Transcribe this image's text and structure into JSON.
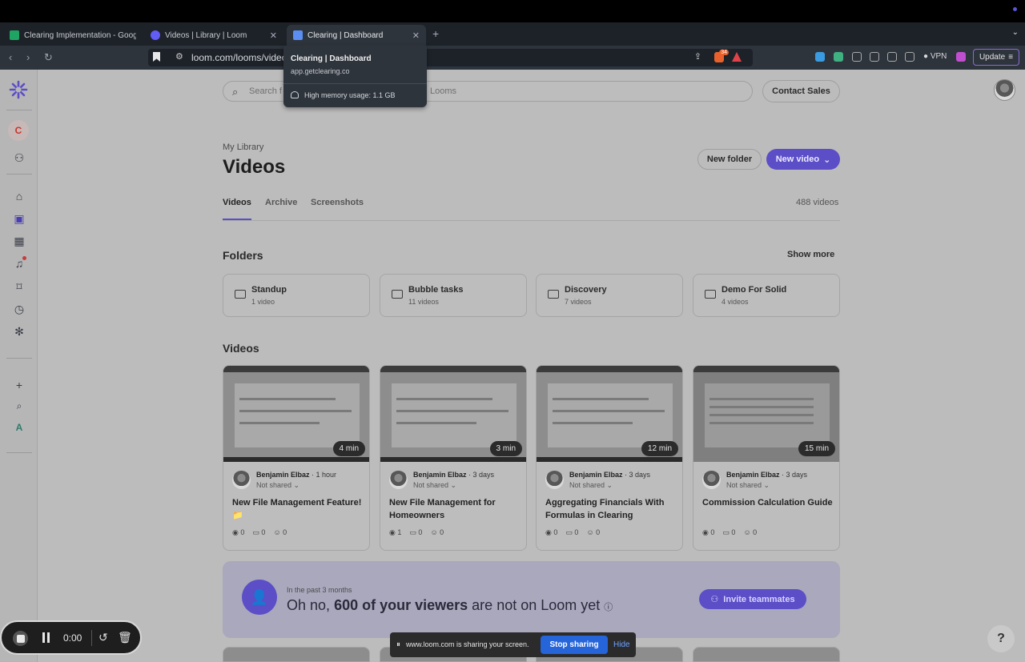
{
  "browser": {
    "tabs": [
      {
        "label": "Clearing Implementation - Googl",
        "favicon_color": "#1fa463"
      },
      {
        "label": "Videos | Library | Loom",
        "favicon_color": "#625df5"
      },
      {
        "label": "Clearing | Dashboard",
        "favicon_color": "#5a8ef0"
      }
    ],
    "url": "loom.com/looms/videos",
    "tooltip": {
      "title": "Clearing | Dashboard",
      "url": "app.getclearing.co",
      "memory": "High memory usage: 1.1 GB"
    },
    "shield_count": "34",
    "vpn_label": "VPN",
    "update_label": "Update"
  },
  "sidebar": {
    "workspace_initial": "C",
    "bottom_letter": "A"
  },
  "search": {
    "placeholder_left": "Search f",
    "placeholder_right": "Looms"
  },
  "contact_sales": "Contact Sales",
  "header": {
    "breadcrumb": "My Library",
    "title": "Videos",
    "new_folder": "New folder",
    "new_video": "New video"
  },
  "tabs": [
    "Videos",
    "Archive",
    "Screenshots"
  ],
  "video_count": "488 videos",
  "folders_section": {
    "title": "Folders",
    "show_more": "Show more",
    "items": [
      {
        "name": "Standup",
        "count": "1 video"
      },
      {
        "name": "Bubble tasks",
        "count": "11 videos"
      },
      {
        "name": "Discovery",
        "count": "7 videos"
      },
      {
        "name": "Demo For Solid",
        "count": "4 videos"
      }
    ]
  },
  "videos_section": {
    "title": "Videos",
    "items": [
      {
        "duration": "4 min",
        "author": "Benjamin Elbaz",
        "time": "· 1 hour",
        "shared": "Not shared",
        "title": "New File Management Feature! 📁",
        "views": "0",
        "comments": "0",
        "reactions": "0"
      },
      {
        "duration": "3 min",
        "author": "Benjamin Elbaz",
        "time": "· 3 days",
        "shared": "Not shared",
        "title": "New File Management for Homeowners",
        "views": "1",
        "comments": "0",
        "reactions": "0"
      },
      {
        "duration": "12 min",
        "author": "Benjamin Elbaz",
        "time": "· 3 days",
        "shared": "Not shared",
        "title": "Aggregating Financials With Formulas in Clearing",
        "views": "0",
        "comments": "0",
        "reactions": "0"
      },
      {
        "duration": "15 min",
        "author": "Benjamin Elbaz",
        "time": "· 3 days",
        "shared": "Not shared",
        "title": "Commission Calculation Guide",
        "views": "0",
        "comments": "0",
        "reactions": "0"
      }
    ]
  },
  "banner": {
    "small": "In the past 3 months",
    "main_pre": "Oh no,",
    "main_bold": "600 of your viewers",
    "main_post": "are not on Loom yet",
    "invite": "Invite teammates"
  },
  "recorder": {
    "time": "0:00"
  },
  "sharing": {
    "text": "www.loom.com is sharing your screen.",
    "stop": "Stop sharing",
    "hide": "Hide"
  },
  "help": "?"
}
